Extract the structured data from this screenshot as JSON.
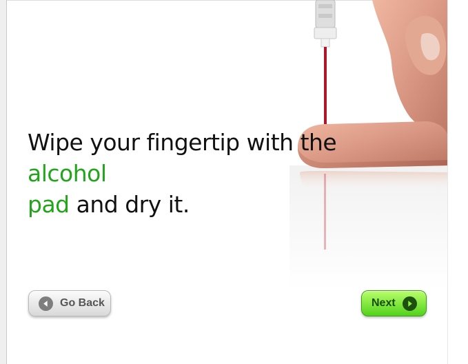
{
  "instruction": {
    "part1": "Wipe your fingertip with the ",
    "highlight1": "alcohol",
    "highlight2": "pad",
    "part2": " and dry it."
  },
  "buttons": {
    "back_label": "Go Back",
    "next_label": "Next"
  },
  "colors": {
    "highlight": "#22a51a",
    "next_button": "#52d21b",
    "back_button": "#d9d9d9"
  },
  "icons": {
    "back": "circle-left-arrow-icon",
    "next": "circle-right-arrow-icon"
  }
}
